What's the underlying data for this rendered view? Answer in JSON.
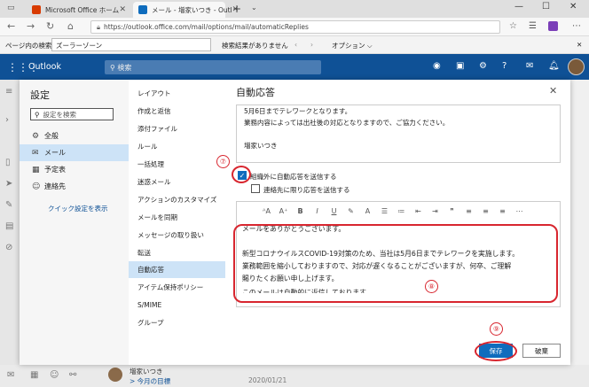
{
  "browser": {
    "tabs": [
      {
        "title": "Microsoft Office ホーム",
        "fav_color": "#d83b01"
      },
      {
        "title": "メール - 増家いつき - Outl",
        "fav_color": "#0f6cbd"
      }
    ],
    "url": "https://outlook.office.com/mail/options/mail/automaticReplies"
  },
  "findbar": {
    "label": "ページ内の検索",
    "query": "ズーラーゾーン",
    "result": "検索結果がありません",
    "options": "オプション ⌵"
  },
  "outlook": {
    "brand": "Outlook",
    "search_placeholder": "検索"
  },
  "settings": {
    "title": "設定",
    "search_placeholder": "設定を検索",
    "nav": [
      "全般",
      "メール",
      "予定表",
      "連絡先"
    ],
    "quick_link": "クイック設定を表示",
    "sub_items": [
      "レイアウト",
      "作成と返信",
      "添付ファイル",
      "ルール",
      "一括処理",
      "迷惑メール",
      "アクションのカスタマイズ",
      "メールを同期",
      "メッセージの取り扱い",
      "転送",
      "自動応答",
      "アイテム保持ポリシー",
      "S/MIME",
      "グループ"
    ],
    "active_sub": "自動応答"
  },
  "auto_reply": {
    "title": "自動応答",
    "preview_lines": [
      "5月6日までテレワークとなります。",
      "業務内容によっては出社後の対応となりますので、ご協力ください。",
      "",
      "増家いつき"
    ],
    "external_label": "組織外に自動応答を送信する",
    "contacts_only_label": "連絡先に限り応答を送信する",
    "body_lines": [
      "メールをありがとうございます。",
      "",
      "新型コロナウイルスCOVID-19対策のため、当社は5月6日までテレワークを実施します。",
      "業務範囲を縮小しておりますので、対応が遅くなることがございますが、何卒、ご理解",
      "賜りたくお願い申し上げます。",
      "このメールは自動的に返信しております。"
    ],
    "save": "保存",
    "discard": "破棄"
  },
  "annotations": [
    "⑦",
    "⑧",
    "⑨"
  ],
  "bg_list": {
    "sender": "増家いつき",
    "subject": "> 今月の目標",
    "date": "2020/01/21"
  }
}
